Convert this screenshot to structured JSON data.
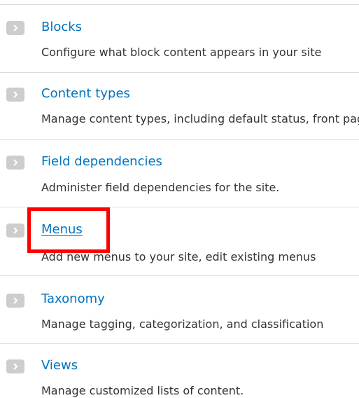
{
  "items": [
    {
      "title": "Blocks",
      "description": "Configure what block content appears in your site"
    },
    {
      "title": "Content types",
      "description": "Manage content types, including default status, front page promotion"
    },
    {
      "title": "Field dependencies",
      "description": "Administer field dependencies for the site."
    },
    {
      "title": "Menus",
      "description": "Add new menus to your site, edit existing menus"
    },
    {
      "title": "Taxonomy",
      "description": "Manage tagging, categorization, and classification"
    },
    {
      "title": "Views",
      "description": "Manage customized lists of content."
    }
  ],
  "colors": {
    "link": "#0074bd",
    "text": "#333333",
    "icon_bg": "#cdcdcd",
    "divider": "#dcdcdc",
    "highlight": "#ff0000"
  },
  "icons": {
    "item_icon": "chevron-right-icon"
  }
}
